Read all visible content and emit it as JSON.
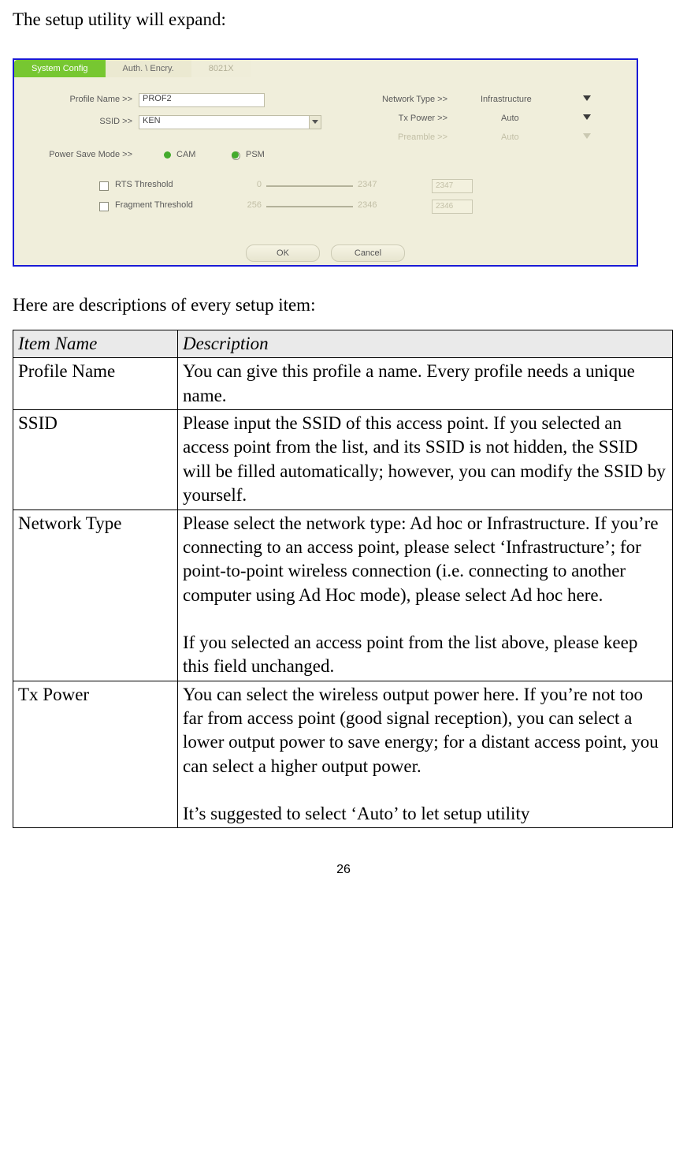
{
  "intro": "The setup utility will expand:",
  "subintro": "Here are descriptions of every setup item:",
  "page_number": "26",
  "shot": {
    "tabs": {
      "system": "System Config",
      "auth": "Auth. \\ Encry.",
      "x8021": "8021X"
    },
    "labels": {
      "profile": "Profile Name >>",
      "ssid": "SSID >>",
      "psm": "Power Save Mode >>",
      "nettype": "Network Type >>",
      "txpower": "Tx Power >>",
      "preamble": "Preamble >>",
      "rts": "RTS Threshold",
      "frag": "Fragment Threshold"
    },
    "values": {
      "profile": "PROF2",
      "ssid": "KEN",
      "cam": "CAM",
      "psm": "PSM",
      "nettype": "Infrastructure",
      "txpower": "Auto",
      "preamble": "Auto",
      "rts_min": "0",
      "rts_max": "2347",
      "rts_val": "2347",
      "frag_min": "256",
      "frag_max": "2346",
      "frag_val": "2346",
      "ok": "OK",
      "cancel": "Cancel"
    }
  },
  "table": {
    "head": {
      "item": "Item Name",
      "desc": "Description"
    },
    "rows": [
      {
        "name": "Profile Name",
        "desc": "You can give this profile a name. Every profile needs a unique name."
      },
      {
        "name": "SSID",
        "desc": "Please input the SSID of this access point. If you selected an access point from the list, and its SSID is not hidden, the SSID will be filled automatically; however, you can modify the SSID by yourself."
      },
      {
        "name": "Network Type",
        "p1": "Please select the network type: Ad hoc or Infrastructure. If you’re connecting to an access point, please select ‘Infrastructure’; for point-to-point wireless connection (i.e. connecting to another computer using Ad Hoc mode), please select Ad hoc here.",
        "p2": "If you selected an access point from the list above, please keep this field unchanged."
      },
      {
        "name": "Tx Power",
        "p1": "You can select the wireless output power here. If you’re not too far from access point (good signal reception), you can select a lower output power to save energy; for a distant access point, you can select a higher output power.",
        "p2": "It’s suggested to select ‘Auto’ to let setup utility"
      }
    ]
  }
}
